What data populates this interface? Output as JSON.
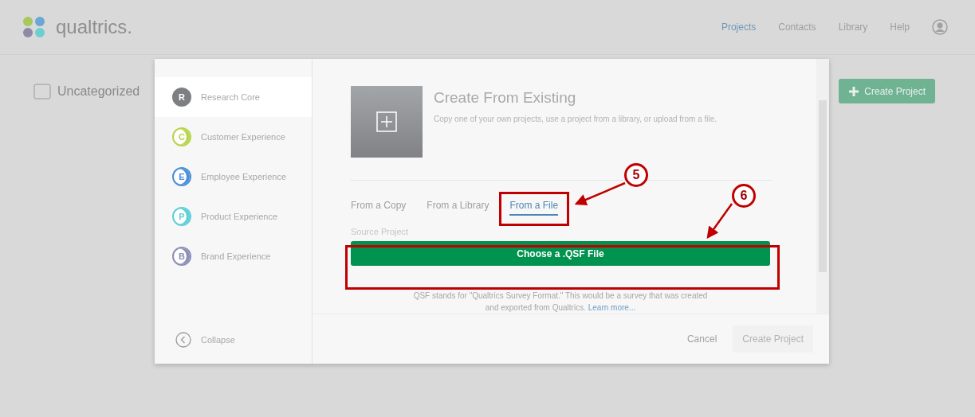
{
  "header": {
    "logo": "qualtrics.",
    "nav": [
      {
        "label": "Projects",
        "selected": true
      },
      {
        "label": "Contacts",
        "selected": false
      },
      {
        "label": "Library",
        "selected": false
      },
      {
        "label": "Help",
        "selected": false
      }
    ]
  },
  "folder": {
    "label": "Uncategorized"
  },
  "create_project_button": {
    "label": "Create Project"
  },
  "dialog": {
    "sidebar": {
      "items": [
        {
          "label": "Research Core",
          "letter": "R",
          "color": "#7d7f82",
          "selected": true
        },
        {
          "label": "Customer Experience",
          "letter": "C",
          "color": "#b8d44a",
          "selected": false
        },
        {
          "label": "Employee Experience",
          "letter": "E",
          "color": "#4a8fd8",
          "selected": false
        },
        {
          "label": "Product Experience",
          "letter": "P",
          "color": "#5ccfd6",
          "selected": false
        },
        {
          "label": "Brand Experience",
          "letter": "B",
          "color": "#8b8fb8",
          "selected": false
        }
      ],
      "collapse": "Collapse"
    },
    "title": "Create From Existing",
    "description": "Copy one of your own projects, use a project from a library, or upload from a file.",
    "tabs": [
      {
        "label": "From a Copy",
        "selected": false
      },
      {
        "label": "From a Library",
        "selected": false
      },
      {
        "label": "From a File",
        "selected": true
      }
    ],
    "source_label": "Source Project",
    "choose_button": "Choose a .QSF File",
    "help_text": "QSF stands for \"Qualtrics Survey Format.\" This would be a survey that was created and exported from Qualtrics.",
    "learn_more": "Learn more...",
    "cancel": "Cancel",
    "create": {
      "label": "Create Project",
      "disabled": true
    }
  },
  "annotations": [
    {
      "number": "5"
    },
    {
      "number": "6"
    }
  ]
}
